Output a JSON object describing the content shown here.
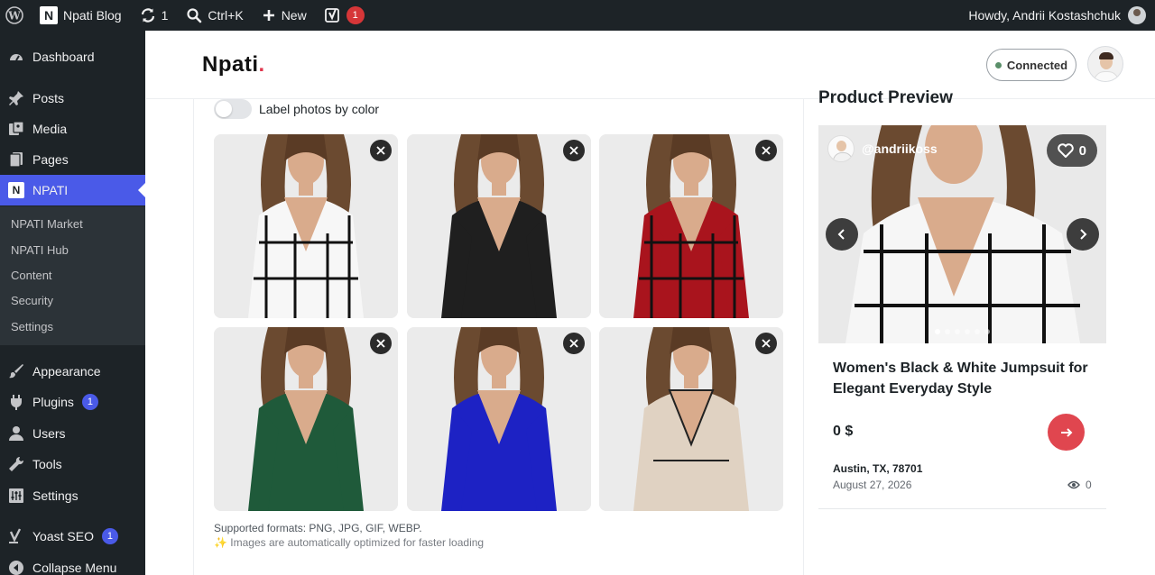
{
  "admin_bar": {
    "site_name": "Npati Blog",
    "updates_count": "1",
    "search_shortcut": "Ctrl+K",
    "new_label": "New",
    "yoast_count": "1",
    "greeting": "Howdy, Andrii Kostashchuk"
  },
  "sidebar": {
    "items": {
      "dashboard": "Dashboard",
      "posts": "Posts",
      "media": "Media",
      "pages": "Pages",
      "npati": "NPATI",
      "appearance": "Appearance",
      "plugins": "Plugins",
      "plugins_badge": "1",
      "users": "Users",
      "tools": "Tools",
      "settings": "Settings",
      "yoast": "Yoast SEO",
      "yoast_badge": "1",
      "collapse": "Collapse Menu"
    },
    "submenu": [
      "NPATI Market",
      "NPATI Hub",
      "Content",
      "Security",
      "Settings"
    ]
  },
  "header": {
    "brand": "Npati",
    "brand_dot": ".",
    "status": "Connected"
  },
  "editor": {
    "toggle_label": "Label photos by color",
    "photos": [
      {
        "color": "White with black grid"
      },
      {
        "color": "Black"
      },
      {
        "color": "Red with black grid"
      },
      {
        "color": "Green"
      },
      {
        "color": "Royal blue"
      },
      {
        "color": "Beige"
      }
    ],
    "formats_note": "Supported formats: PNG, JPG, GIF, WEBP.",
    "optimize_note": "✨ Images are automatically optimized for faster loading"
  },
  "preview": {
    "title": "Product Preview",
    "username": "@andriikoss",
    "likes": "0",
    "product_title": "Women's Black & White Jumpsuit for Elegant Everyday Style",
    "price": "0 $",
    "location": "Austin, TX, 78701",
    "date": "August 27, 2026",
    "views": "0"
  },
  "colors": {
    "wp_dark": "#1d2327",
    "accent": "#4a5ae8",
    "cta": "#e0464f",
    "badge_red": "#d63638",
    "photo_swatches": [
      "#f4f4f4",
      "#1f1f1f",
      "#a9141d",
      "#1f5a3a",
      "#1d22c4",
      "#e0d2c2"
    ]
  }
}
